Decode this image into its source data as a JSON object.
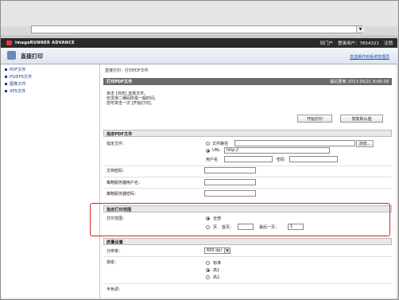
{
  "app": {
    "brand": "imageRUNNER ADVANCE",
    "title": "直接打印",
    "header_links": {
      "login": "到门户",
      "user_label": "登录用户：",
      "user_value": "7654321",
      "logout": "注销"
    },
    "email_link": "发送邮件到系统管理员"
  },
  "sidebar": {
    "items": [
      {
        "label": "PDF文件"
      },
      {
        "label": "PS/EPS文件"
      },
      {
        "label": "图像文件"
      },
      {
        "label": "XPS文件"
      }
    ]
  },
  "main": {
    "breadcrumb": "直接打印：打印PDF文件",
    "section_title": "打印PDF文件",
    "last_update_label": "最近更新",
    "last_update_value": "2013 05/21 8:06:28",
    "note_lines": [
      "单击 [浏览] 选择文件。",
      "仅支持二维码所需一般时间。",
      "您可单击一次 [开始打印]。"
    ],
    "start_print_button": "开始打印",
    "restore_defaults_button": "恢复默认值",
    "specify_pdf": {
      "title": "指定PDF文件",
      "file_label": "指定文件：",
      "file_path_option": "文件路径",
      "browse_button": "浏览...",
      "url_option": "URL",
      "url_value": "http://",
      "username_label": "用户名",
      "password_label": "密码",
      "doc_password_label": "文档密码：",
      "policy_user_label": "策略服务器用户名：",
      "policy_password_label": "策略服务器密码："
    },
    "print_range": {
      "title": "指定打印范围",
      "range_label": "打印范围：",
      "all_option": "全部",
      "pages_option": "页",
      "first_page_label": "首页：",
      "last_page_label": "最后一页：",
      "last_page_value": "1"
    },
    "quality": {
      "title": "质量设置",
      "resolution_label": "分辨率：",
      "resolution_value": "600 dpi",
      "gradation_label": "渐变：",
      "gradation_options": [
        "标准",
        "高1",
        "高2"
      ],
      "halftone_label": "半色调："
    }
  }
}
